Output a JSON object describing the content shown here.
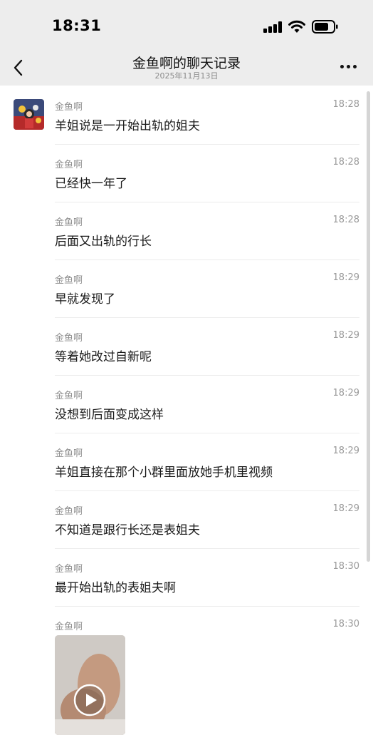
{
  "status_bar": {
    "time": "18:31"
  },
  "nav": {
    "title": "金鱼啊的聊天记录",
    "date": "2025年11月13日",
    "back_icon": "chevron-left-icon",
    "more_icon": "more-dots-icon"
  },
  "messages": [
    {
      "sender": "金鱼啊",
      "time": "18:28",
      "text": "羊姐说是一开始出轨的姐夫"
    },
    {
      "sender": "金鱼啊",
      "time": "18:28",
      "text": "已经快一年了"
    },
    {
      "sender": "金鱼啊",
      "time": "18:28",
      "text": "后面又出轨的行长"
    },
    {
      "sender": "金鱼啊",
      "time": "18:29",
      "text": "早就发现了"
    },
    {
      "sender": "金鱼啊",
      "time": "18:29",
      "text": "等着她改过自新呢"
    },
    {
      "sender": "金鱼啊",
      "time": "18:29",
      "text": "没想到后面变成这样"
    },
    {
      "sender": "金鱼啊",
      "time": "18:29",
      "text": "羊姐直接在那个小群里面放她手机里视频"
    },
    {
      "sender": "金鱼啊",
      "time": "18:29",
      "text": "不知道是跟行长还是表姐夫"
    },
    {
      "sender": "金鱼啊",
      "time": "18:30",
      "text": "最开始出轨的表姐夫啊"
    },
    {
      "sender": "金鱼啊",
      "time": "18:30",
      "type": "video",
      "icon": "play-icon"
    }
  ],
  "colors": {
    "header_bg": "#ededed",
    "list_bg": "#ffffff",
    "sender_text": "#8f8f8f",
    "divider": "#ececec"
  }
}
